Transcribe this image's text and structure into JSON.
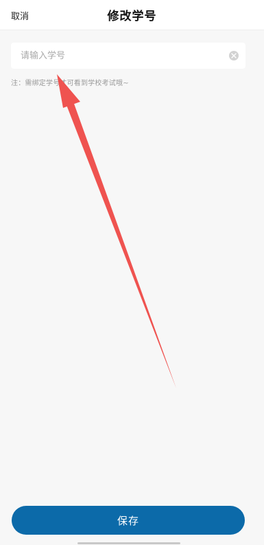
{
  "header": {
    "cancel_label": "取消",
    "title": "修改学号"
  },
  "form": {
    "student_id_placeholder": "请输入学号",
    "student_id_value": "",
    "clear_icon": "clear-circle-icon",
    "note": "注：需绑定学号才可看到学校考试哦~"
  },
  "footer": {
    "save_label": "保存"
  },
  "colors": {
    "primary": "#0c6aa9",
    "annotation_arrow": "#ef5350"
  }
}
